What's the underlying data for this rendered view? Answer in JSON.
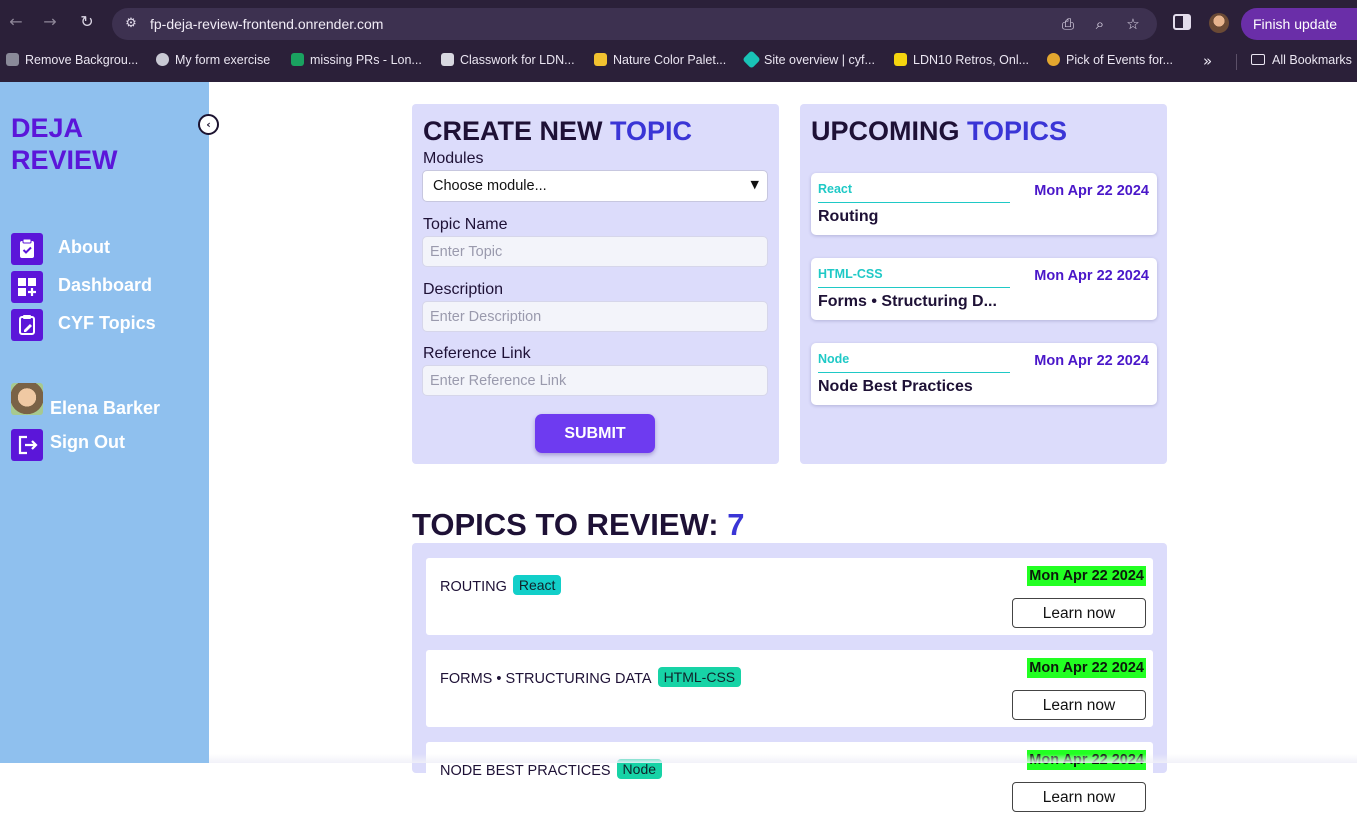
{
  "browser": {
    "url": "fp-deja-review-frontend.onrender.com",
    "finish_update": "Finish update",
    "bookmarks": [
      {
        "label": "Remove Backgrou...",
        "color": "#8a8a99"
      },
      {
        "label": "My form exercise",
        "color": "#c9c9d4"
      },
      {
        "label": "missing PRs - Lon...",
        "color": "#1aa260"
      },
      {
        "label": "Classwork for LDN...",
        "color": "#d8d8e0"
      },
      {
        "label": "Nature Color Palet...",
        "color": "#f2c230"
      },
      {
        "label": "Site overview | cyf...",
        "color": "#19c3b6"
      },
      {
        "label": "LDN10 Retros, Onl...",
        "color": "#f5d50f"
      },
      {
        "label": "Pick of Events for...",
        "color": "#e3a72f"
      }
    ],
    "all_bookmarks": "All Bookmarks"
  },
  "sidebar": {
    "brand_line1": "DEJA",
    "brand_line2": "REVIEW",
    "items": [
      {
        "label": "About",
        "icon": "clipboard-check-icon"
      },
      {
        "label": "Dashboard",
        "icon": "dashboard-add-icon"
      },
      {
        "label": "CYF Topics",
        "icon": "clipboard-edit-icon"
      }
    ],
    "user_name": "Elena Barker",
    "sign_out": "Sign Out"
  },
  "create": {
    "title_main": "CREATE NEW ",
    "title_accent": "TOPIC",
    "modules_label": "Modules",
    "modules_value": "Choose module...",
    "topic_label": "Topic Name",
    "topic_placeholder": "Enter Topic",
    "desc_label": "Description",
    "desc_placeholder": "Enter Description",
    "ref_label": "Reference Link",
    "ref_placeholder": "Enter Reference Link",
    "submit": "SUBMIT"
  },
  "upcoming": {
    "title_main": "UPCOMING ",
    "title_accent": "TOPICS",
    "items": [
      {
        "module": "React",
        "date": "Mon Apr 22 2024",
        "name": "Routing"
      },
      {
        "module": "HTML-CSS",
        "date": "Mon Apr 22 2024",
        "name": "Forms • Structuring D..."
      },
      {
        "module": "Node",
        "date": "Mon Apr 22 2024",
        "name": "Node Best Practices"
      }
    ]
  },
  "review": {
    "heading": "TOPICS TO REVIEW: ",
    "count": "7",
    "rows": [
      {
        "name": "ROUTING",
        "badge": "React",
        "badge_color": "#12cfc9",
        "date": "Mon Apr 22 2024",
        "button": "Learn now"
      },
      {
        "name": "FORMS • STRUCTURING DATA",
        "badge": "HTML-CSS",
        "badge_color": "#17d3a6",
        "date": "Mon Apr 22 2024",
        "button": "Learn now"
      },
      {
        "name": "NODE BEST PRACTICES",
        "badge": "Node",
        "badge_color": "#17d3a6",
        "date": "Mon Apr 22 2024",
        "button": "Learn now"
      }
    ]
  }
}
